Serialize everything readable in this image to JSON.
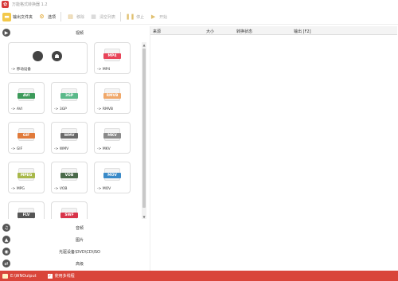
{
  "window": {
    "title": "万能格式转换器 1.2"
  },
  "toolbar": {
    "output_folder": "输出文件夹",
    "options": "选项",
    "remove": "移除",
    "clear_list": "清空列表",
    "stop": "停止",
    "start": "开始"
  },
  "categories": {
    "video": "视频",
    "audio": "音频",
    "image": "图片",
    "disc": "光驱设备\\DVD\\CD\\ISO",
    "advanced": "高级"
  },
  "formats": [
    {
      "badge": "",
      "label": "-> 移动设备",
      "color": "#444444",
      "big": true
    },
    {
      "badge": "MP4",
      "label": "-> MP4",
      "color": "#e8455a"
    },
    {
      "badge": "AVI",
      "label": "-> AVI",
      "color": "#3c9a5a"
    },
    {
      "badge": "3GP",
      "label": "-> 3GP",
      "color": "#5bb98a"
    },
    {
      "badge": "RMVB",
      "label": "-> RMVB",
      "color": "#f0a86a"
    },
    {
      "badge": "GIF",
      "label": "-> GIF",
      "color": "#e07a3a"
    },
    {
      "badge": "WMV",
      "label": "-> WMV",
      "color": "#6a6a6a"
    },
    {
      "badge": "MKV",
      "label": "-> MKV",
      "color": "#8a8a8a"
    },
    {
      "badge": "MPEG",
      "label": "-> MPG",
      "color": "#a8b84a"
    },
    {
      "badge": "VOB",
      "label": "-> VOB",
      "color": "#4a6a4a"
    },
    {
      "badge": "MOV",
      "label": "-> MOV",
      "color": "#3a8ac8"
    },
    {
      "badge": "FLV",
      "label": "",
      "color": "#555555"
    },
    {
      "badge": "SWF",
      "label": "",
      "color": "#d8344a"
    }
  ],
  "table": {
    "columns": [
      "来源",
      "大小",
      "转换状态",
      "输出 [F2]"
    ]
  },
  "status": {
    "path": "E:\\WNOutput",
    "option": "使用多线程"
  },
  "colors": {
    "accent": "#d9453a"
  }
}
